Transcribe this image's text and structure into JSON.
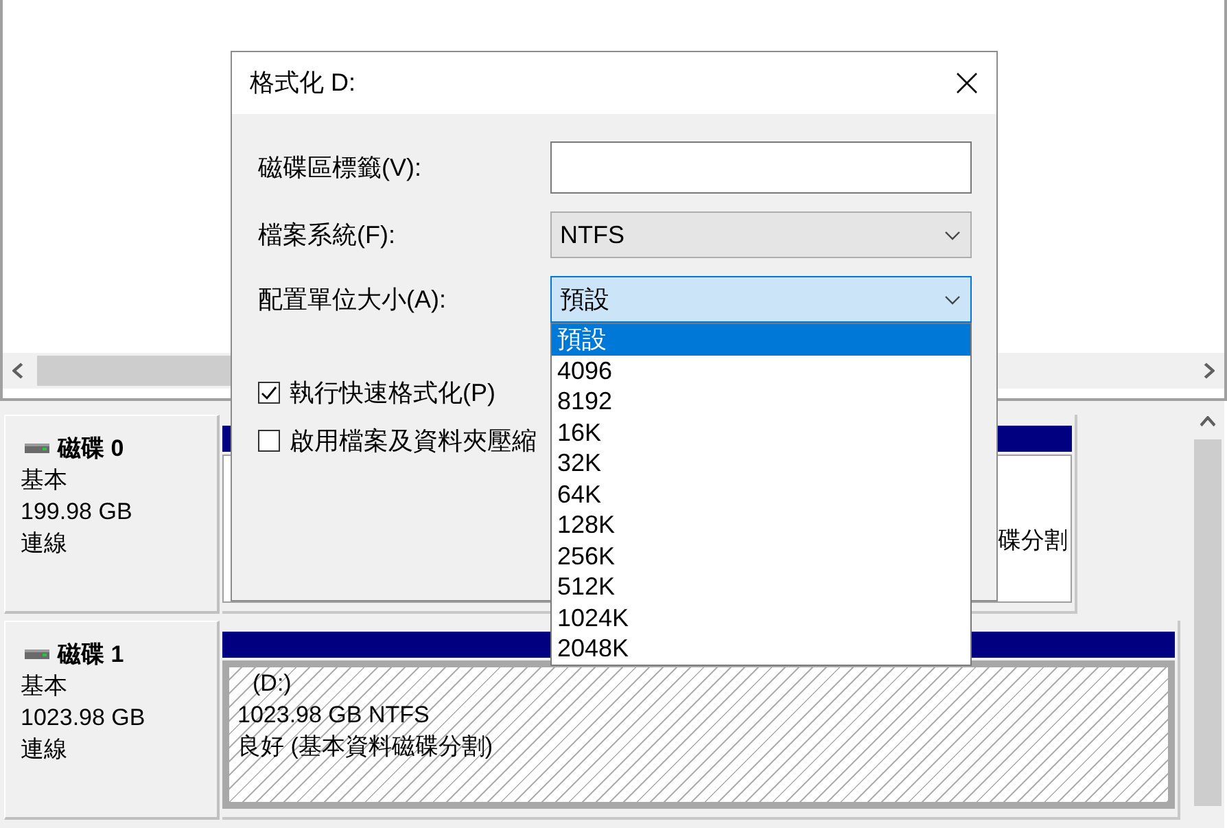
{
  "disk_management": {
    "disks": [
      {
        "name": "磁碟 0",
        "type": "基本",
        "size": "199.98 GB",
        "status": "連線",
        "partition": {
          "selected": false,
          "status": "碟分割"
        }
      },
      {
        "name": "磁碟 1",
        "type": "基本",
        "size": "1023.98 GB",
        "status": "連線",
        "partition": {
          "selected": true,
          "label": "(D:)",
          "size": "1023.98 GB NTFS",
          "status": "良好 (基本資料磁碟分割)"
        }
      }
    ]
  },
  "dialog": {
    "title": "格式化 D:",
    "fields": [
      {
        "kind": "text",
        "label": "磁碟區標籤(V):"
      },
      {
        "kind": "select",
        "label": "檔案系統(F):",
        "value": "NTFS",
        "focused": false,
        "expanded": false
      },
      {
        "kind": "select",
        "label": "配置單位大小(A):",
        "value": "預設",
        "focused": true,
        "expanded": true,
        "options": [
          {
            "label": "預設",
            "selected": true
          },
          {
            "label": "4096",
            "selected": false
          },
          {
            "label": "8192",
            "selected": false
          },
          {
            "label": "16K",
            "selected": false
          },
          {
            "label": "32K",
            "selected": false
          },
          {
            "label": "64K",
            "selected": false
          },
          {
            "label": "128K",
            "selected": false
          },
          {
            "label": "256K",
            "selected": false
          },
          {
            "label": "512K",
            "selected": false
          },
          {
            "label": "1024K",
            "selected": false
          },
          {
            "label": "2048K",
            "selected": false
          }
        ]
      }
    ],
    "checkboxes": [
      {
        "label": "執行快速格式化(P)",
        "checked": true
      },
      {
        "label": "啟用檔案及資料夾壓縮",
        "checked": false
      }
    ]
  }
}
